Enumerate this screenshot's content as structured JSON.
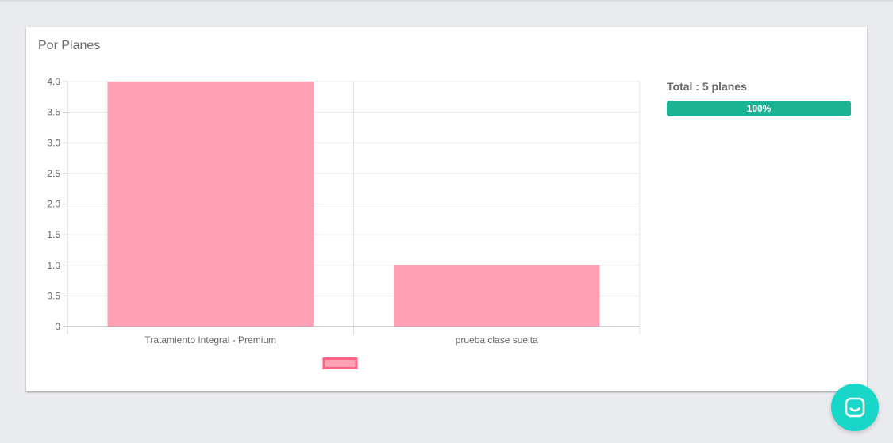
{
  "card": {
    "title": "Por Planes"
  },
  "summary": {
    "total_text": "Total : 5 planes",
    "progress_label": "100%",
    "progress_percent": 100
  },
  "chart_data": {
    "type": "bar",
    "categories": [
      "Tratamiento Integral - Premium",
      "prueba clase suelta"
    ],
    "values": [
      4,
      1
    ],
    "ylim": [
      0,
      4
    ],
    "yticks": [
      "0",
      "0.5",
      "1.0",
      "1.5",
      "2.0",
      "2.5",
      "3.0",
      "3.5",
      "4.0"
    ],
    "grid": true,
    "legend": "bottom",
    "bar_color": "#ffa0b4",
    "legend_border_color": "#ff6384"
  },
  "colors": {
    "progress": "#1ab394",
    "chat": "#18d7c8"
  },
  "icons": {
    "chat": "chat-bubble-icon"
  }
}
